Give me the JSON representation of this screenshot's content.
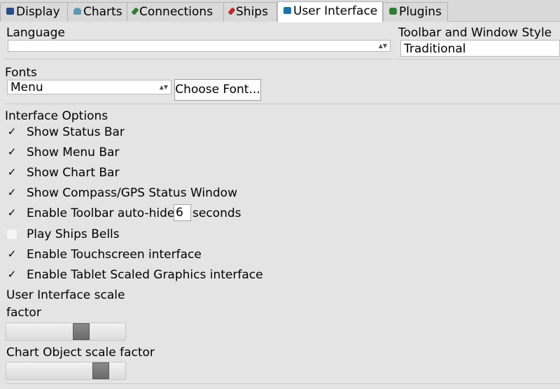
{
  "tabs": [
    {
      "label": "Display",
      "icon": "display-icon",
      "color": "#2a4a8a"
    },
    {
      "label": "Charts",
      "icon": "charts-icon",
      "color": "#5a9ab0"
    },
    {
      "label": "Connections",
      "icon": "connections-icon",
      "color": "#2e7d32"
    },
    {
      "label": "Ships",
      "icon": "ships-icon",
      "color": "#c62828"
    },
    {
      "label": "User Interface",
      "icon": "user-interface-icon",
      "color": "#1976a8"
    },
    {
      "label": "Plugins",
      "icon": "plugins-icon",
      "color": "#2e7d32"
    }
  ],
  "active_tab": "User Interface",
  "language": {
    "label": "Language",
    "value": ""
  },
  "toolbar_style": {
    "label": "Toolbar and Window Style",
    "value": "Traditional"
  },
  "fonts": {
    "label": "Fonts",
    "value": "Menu",
    "button": "Choose Font..."
  },
  "interface_options": {
    "label": "Interface Options",
    "items": [
      {
        "label": "Show Status Bar",
        "checked": true
      },
      {
        "label": "Show Menu Bar",
        "checked": true
      },
      {
        "label": "Show Chart Bar",
        "checked": true
      },
      {
        "label": "Show Compass/GPS Status Window",
        "checked": true
      },
      {
        "label": "Enable Toolbar auto-hide",
        "checked": true,
        "value": "6",
        "suffix": "seconds"
      },
      {
        "label": "Play Ships Bells",
        "checked": false
      },
      {
        "label": "Enable Touchscreen interface",
        "checked": true
      },
      {
        "label": "Enable Tablet Scaled Graphics interface",
        "checked": true
      }
    ]
  },
  "ui_scale": {
    "label_line1": "User Interface scale",
    "label_line2": "factor",
    "level": 0.65
  },
  "chart_scale": {
    "label": "Chart Object scale factor",
    "level": 0.84
  },
  "check_mark": "✓"
}
